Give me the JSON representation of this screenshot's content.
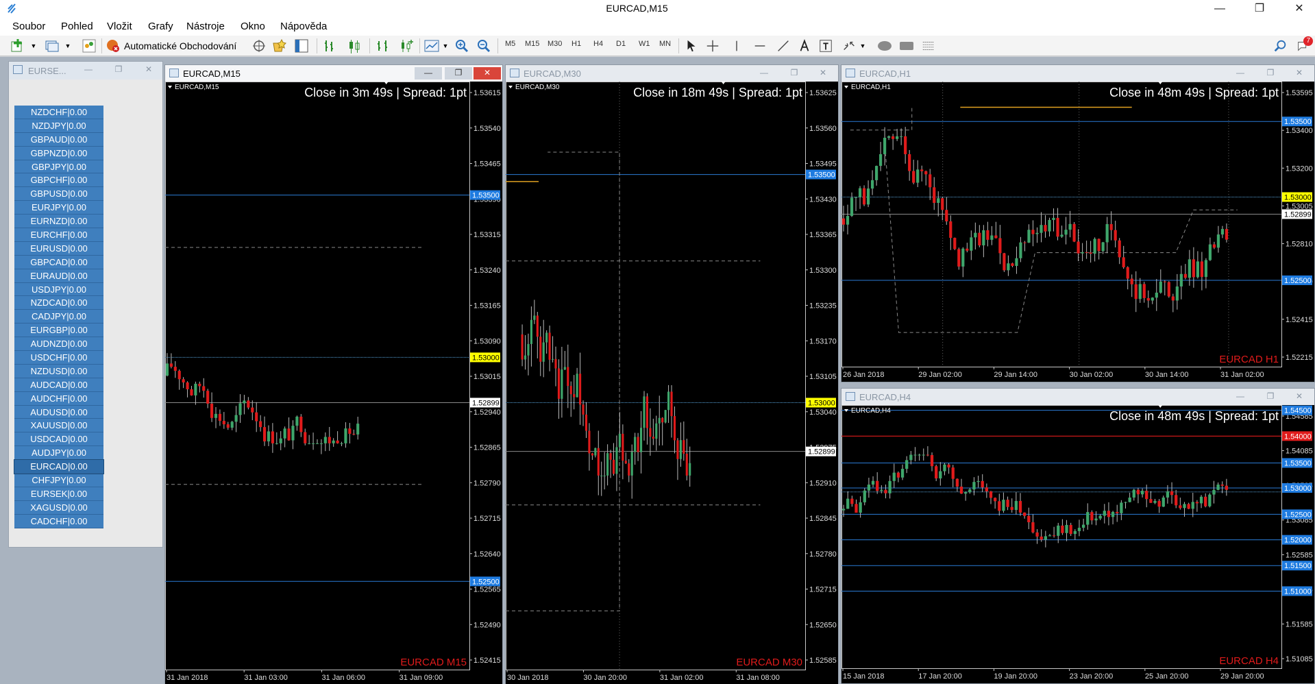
{
  "window": {
    "title": "EURCAD,M15",
    "minimize": "—",
    "maximize": "❐",
    "close": "✕"
  },
  "menu": [
    "Soubor",
    "Pohled",
    "Vložit",
    "Grafy",
    "Nástroje",
    "Okno",
    "Nápověda"
  ],
  "toolbar": {
    "algo_label": "Automatické Obchodování",
    "timeframes": [
      "M5",
      "M15",
      "M30",
      "H1",
      "H4",
      "D1",
      "W1",
      "MN"
    ],
    "notification_count": "7"
  },
  "market_watch": {
    "title": "EURSE...",
    "selected": "EURCAD",
    "items": [
      "NZDCHF|0.00",
      "NZDJPY|0.00",
      "GBPAUD|0.00",
      "GBPNZD|0.00",
      "GBPJPY|0.00",
      "GBPCHF|0.00",
      "GBPUSD|0.00",
      "EURJPY|0.00",
      "EURNZD|0.00",
      "EURCHF|0.00",
      "EURUSD|0.00",
      "GBPCAD|0.00",
      "EURAUD|0.00",
      "USDJPY|0.00",
      "NZDCAD|0.00",
      "CADJPY|0.00",
      "EURGBP|0.00",
      "AUDNZD|0.00",
      "USDCHF|0.00",
      "NZDUSD|0.00",
      "AUDCAD|0.00",
      "AUDCHF|0.00",
      "AUDUSD|0.00",
      "XAUUSD|0.00",
      "USDCAD|0.00",
      "AUDJPY|0.00",
      "EURCAD|0.00",
      "CHFJPY|0.00",
      "EURSEK|0.00",
      "XAGUSD|0.00",
      "CADCHF|0.00"
    ]
  },
  "colors": {
    "bull": "#3fa66b",
    "bear": "#e01b1b",
    "level": "#2b7bd6",
    "price_tag_yellow": "#ffff00",
    "price_tag_blue": "#1e7be0",
    "price_tag_red": "#e01b1b",
    "watermark": "#e01b1b"
  },
  "charts": [
    {
      "id": "m15",
      "window_title": "EURCAD,M15",
      "active": true,
      "symbol_label": "EURCAD,M15",
      "countdown": "Close in 3m 49s | Spread: 1pt",
      "watermark": "EURCAD M15",
      "price_labels": [
        "1.53615",
        "1.53540",
        "1.53465",
        "1.53390",
        "1.53315",
        "1.53240",
        "1.53165",
        "1.53090",
        "1.53015",
        "1.52940",
        "1.52865",
        "1.52790",
        "1.52715",
        "1.52640",
        "1.52565",
        "1.52490",
        "1.52415"
      ],
      "tags": [
        {
          "text": "1.53500",
          "kind": "blue"
        },
        {
          "text": "1.53000",
          "kind": "yellow"
        },
        {
          "text": "1.52899",
          "kind": "white"
        },
        {
          "text": "1.52500",
          "kind": "blue"
        }
      ],
      "dates": [
        "31 Jan 2018",
        "31 Jan 03:00",
        "31 Jan 06:00",
        "31 Jan 09:00"
      ]
    },
    {
      "id": "m30",
      "window_title": "EURCAD,M30",
      "active": false,
      "symbol_label": "EURCAD,M30",
      "countdown": "Close in 18m 49s | Spread: 1pt",
      "watermark": "EURCAD M30",
      "price_labels": [
        "1.53625",
        "1.53560",
        "1.53495",
        "1.53430",
        "1.53365",
        "1.53300",
        "1.53235",
        "1.53170",
        "1.53105",
        "1.53040",
        "1.52975",
        "1.52910",
        "1.52845",
        "1.52780",
        "1.52715",
        "1.52650",
        "1.52585"
      ],
      "tags": [
        {
          "text": "1.53500",
          "kind": "blue"
        },
        {
          "text": "1.53000",
          "kind": "yellow"
        },
        {
          "text": "1.52899",
          "kind": "white"
        }
      ],
      "dates": [
        "30 Jan 2018",
        "30 Jan 20:00",
        "31 Jan 02:00",
        "31 Jan 08:00"
      ]
    },
    {
      "id": "h1",
      "window_title": "EURCAD,H1",
      "active": false,
      "symbol_label": "EURCAD,H1",
      "countdown": "Close in 48m 49s | Spread: 1pt",
      "watermark": "EURCAD H1",
      "price_labels": [
        "1.53595",
        "1.53400",
        "1.53200",
        "1.53005",
        "1.52810",
        "1.52610",
        "1.52415",
        "1.52215"
      ],
      "tags": [
        {
          "text": "1.53500",
          "kind": "blue"
        },
        {
          "text": "1.53000",
          "kind": "yellow"
        },
        {
          "text": "1.52899",
          "kind": "white"
        },
        {
          "text": "1.52500",
          "kind": "blue"
        }
      ],
      "dates": [
        "26 Jan 2018",
        "29 Jan 02:00",
        "29 Jan 14:00",
        "30 Jan 02:00",
        "30 Jan 14:00",
        "31 Jan 02:00"
      ]
    },
    {
      "id": "h4",
      "window_title": "EURCAD,H4",
      "active": false,
      "symbol_label": "EURCAD,H4",
      "countdown": "Close in 48m 49s | Spread: 1pt",
      "watermark": "EURCAD H4",
      "price_labels": [
        "1.54585",
        "1.54085",
        "1.53585",
        "1.53085",
        "1.52585",
        "1.52085",
        "1.51585",
        "1.51085"
      ],
      "tags": [
        {
          "text": "1.54500",
          "kind": "blue"
        },
        {
          "text": "1.54000",
          "kind": "red"
        },
        {
          "text": "1.53500",
          "kind": "blue"
        },
        {
          "text": "1.53000",
          "kind": "blue"
        },
        {
          "text": "1.52500",
          "kind": "blue"
        },
        {
          "text": "1.52000",
          "kind": "blue"
        },
        {
          "text": "1.51500",
          "kind": "blue"
        },
        {
          "text": "1.51000",
          "kind": "blue"
        }
      ],
      "dates": [
        "15 Jan 2018",
        "17 Jan 20:00",
        "19 Jan 20:00",
        "23 Jan 20:00",
        "25 Jan 20:00",
        "29 Jan 20:00"
      ]
    }
  ]
}
